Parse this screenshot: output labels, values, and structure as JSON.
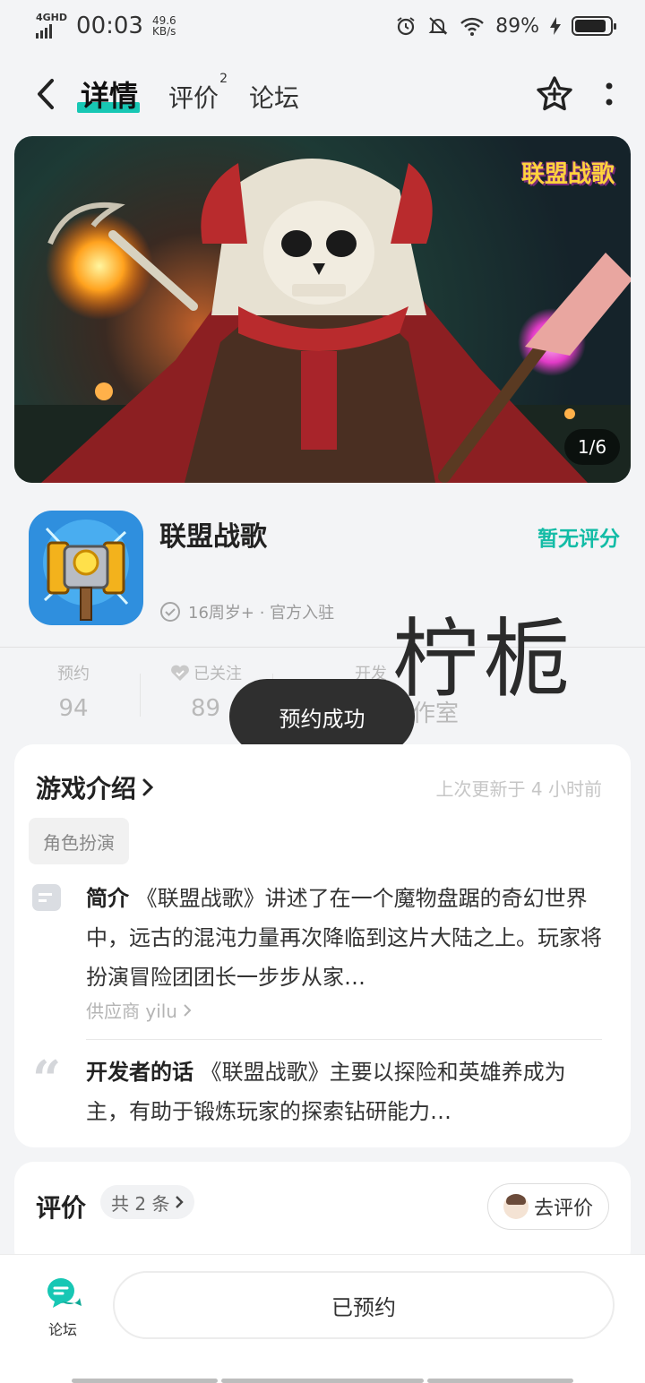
{
  "status_bar": {
    "network": "4GHD",
    "time": "00:03",
    "speed_value": "49.6",
    "speed_unit": "KB/s",
    "battery": "89%",
    "battery_level": 0.89
  },
  "nav": {
    "tabs": [
      {
        "label": "详情",
        "active": true
      },
      {
        "label": "评价",
        "badge": "2"
      },
      {
        "label": "论坛"
      }
    ]
  },
  "banner": {
    "logo_text": "联盟战歌",
    "counter": "1/6"
  },
  "game": {
    "title": "联盟战歌",
    "rating": "暂无评分",
    "meta": "16周岁+ · 官方入驻"
  },
  "stats": [
    {
      "label": "预约",
      "value": "94"
    },
    {
      "label": "已关注",
      "value": "89"
    },
    {
      "label": "开发",
      "value": "作室"
    }
  ],
  "watermark": "柠栀",
  "toast": "预约成功",
  "intro": {
    "title": "游戏介绍",
    "updated": "上次更新于 4 小时前",
    "tag": "角色扮演",
    "summary_label": "简介",
    "summary_text": " 《联盟战歌》讲述了在一个魔物盘踞的奇幻世界中，远古的混沌力量再次降临到这片大陆之上。玩家将扮演冒险团团长一步步从家…",
    "provider": "供应商 yilu",
    "dev_label": "开发者的话",
    "dev_text": " 《联盟战歌》主要以探险和英雄养成为主，有助于锻炼玩家的探索钻研能力…"
  },
  "reviews": {
    "title": "评价",
    "count": "共 2 条",
    "action": "去评价"
  },
  "bottom": {
    "forum_label": "论坛",
    "main_button": "已预约"
  },
  "colors": {
    "accent": "#17c7b4",
    "rating_green": "#13bca6",
    "toast_bg": "#2f2f2f"
  }
}
